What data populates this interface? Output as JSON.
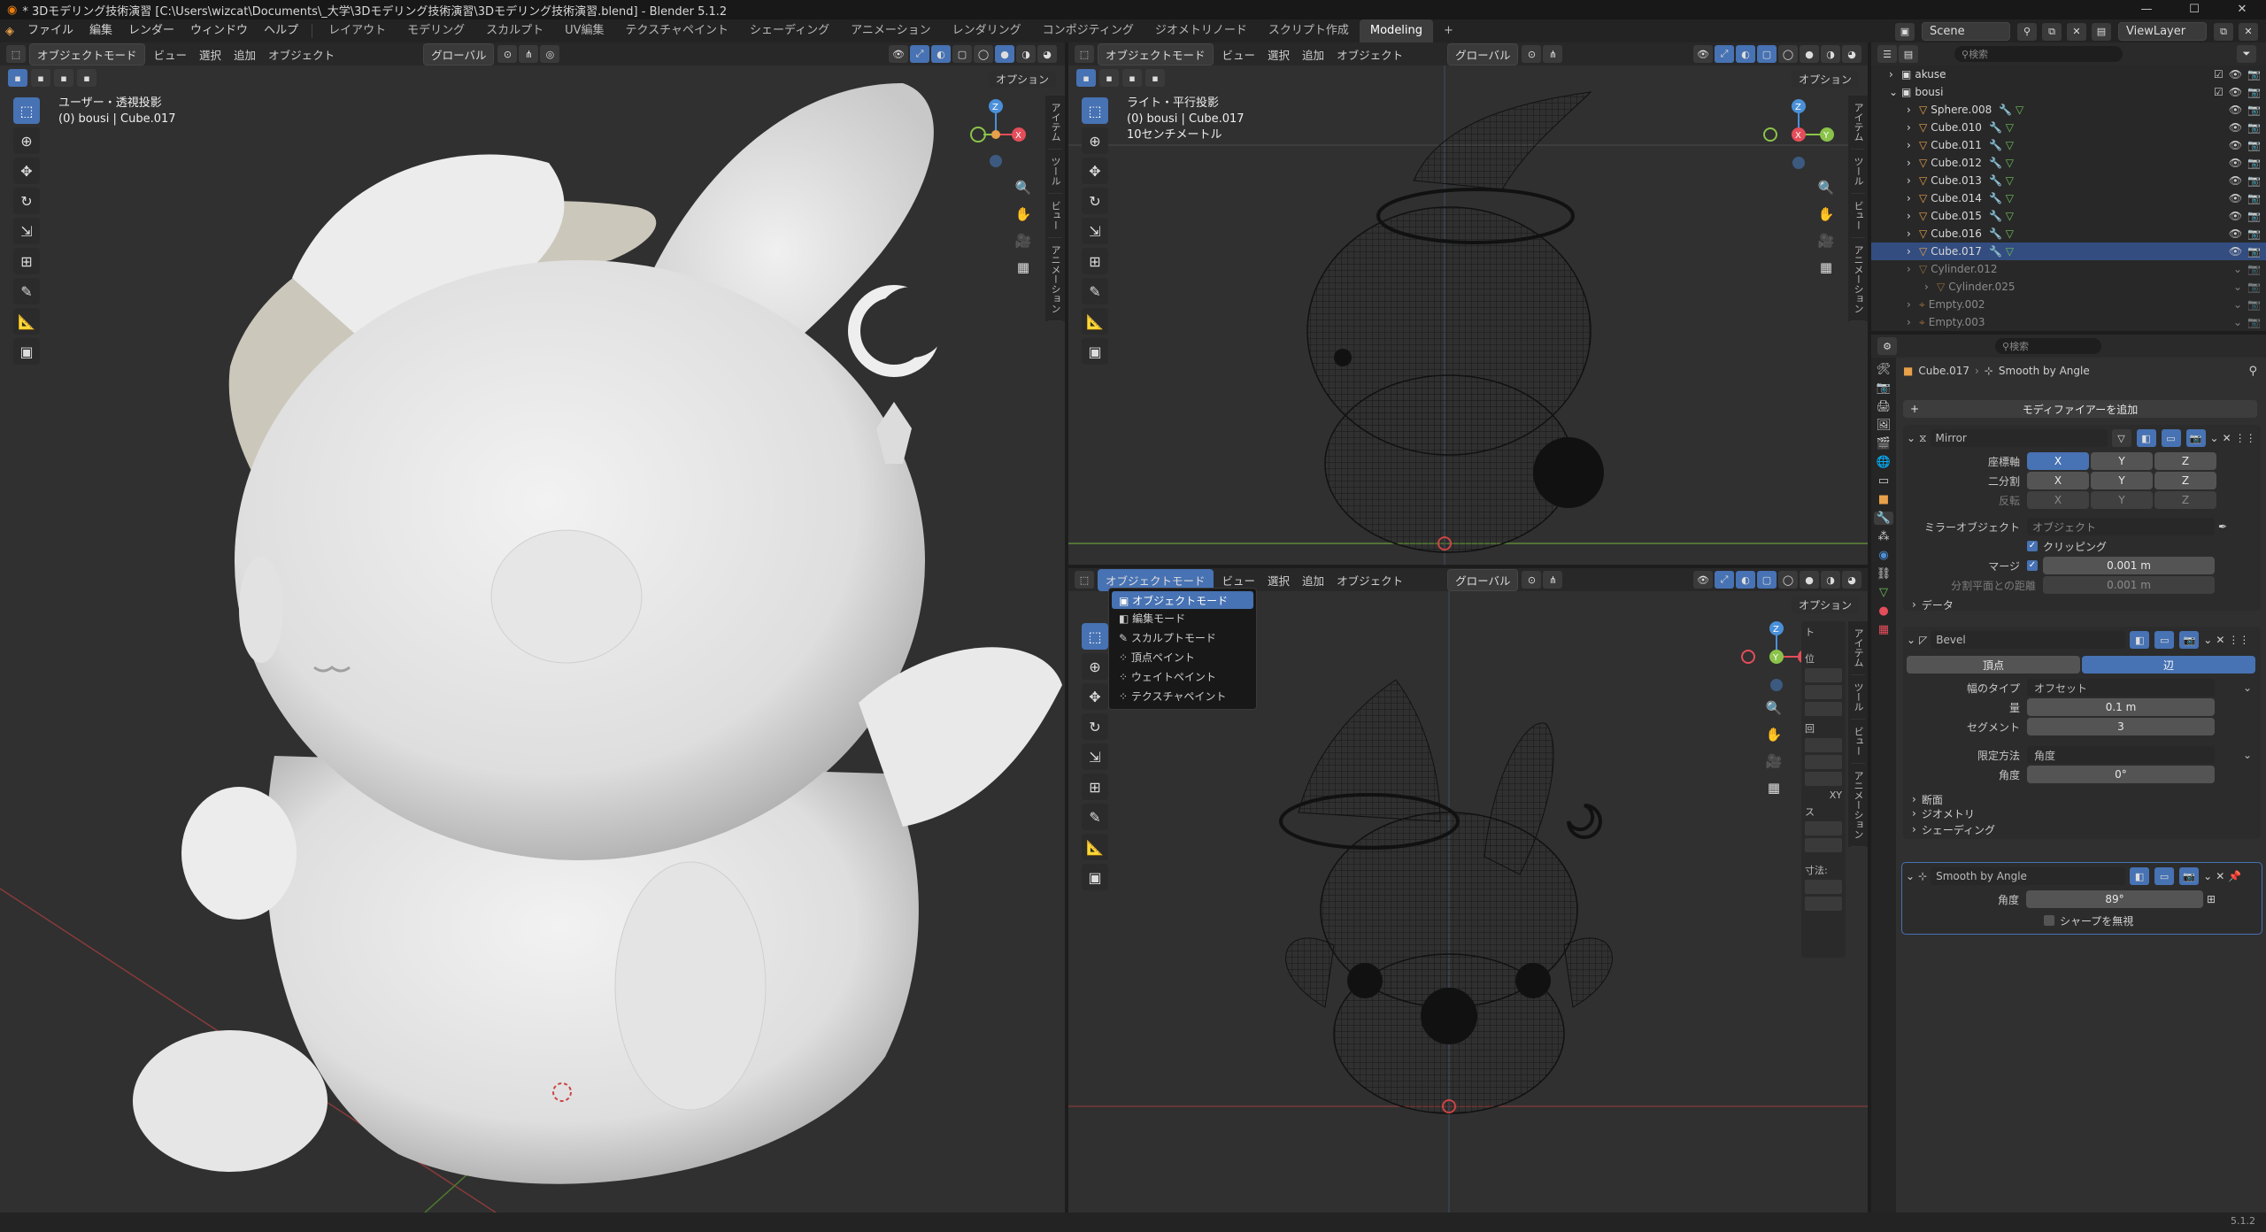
{
  "title": "* 3Dモデリング技術演習 [C:\\Users\\wizcat\\Documents\\_大学\\3Dモデリング技術演習\\3Dモデリング技術演習.blend] - Blender 5.1.2",
  "menu": [
    "ファイル",
    "編集",
    "レンダー",
    "ウィンドウ",
    "ヘルプ"
  ],
  "workspaces": [
    "レイアウト",
    "モデリング",
    "スカルプト",
    "UV編集",
    "テクスチャペイント",
    "シェーディング",
    "アニメーション",
    "レンダリング",
    "コンポジティング",
    "ジオメトリノード",
    "スクリプト作成",
    "Modeling"
  ],
  "active_workspace": "Modeling",
  "add_tab": "+",
  "scene": "Scene",
  "view_layer": "ViewLayer",
  "version": "5.1.2",
  "viewport_header": {
    "mode": "オブジェクトモード",
    "items": [
      "ビュー",
      "選択",
      "追加",
      "オブジェクト"
    ],
    "transform": "グローバル",
    "options": "オプション"
  },
  "left_viewport": {
    "overlay_line1": "ユーザー・透視投影",
    "overlay_line2": "(0) bousi | Cube.017"
  },
  "right_top_viewport": {
    "overlay_line1": "ライト・平行投影",
    "overlay_line2": "(0) bousi | Cube.017",
    "overlay_line3": "10センチメートル"
  },
  "side_tabs": [
    "アイテム",
    "ツール",
    "ビュー",
    "アニメーション"
  ],
  "gizmo": {
    "x": "X",
    "y": "Y",
    "z": "Z"
  },
  "mode_menu": {
    "items": [
      "オブジェクトモード",
      "編集モード",
      "スカルプトモード",
      "頂点ペイント",
      "ウェイトペイント",
      "テクスチャペイント"
    ],
    "selected": 0
  },
  "n_panel": {
    "labels": [
      "ト",
      "位",
      "回",
      "ス",
      "寸法:"
    ],
    "xy": "XY"
  },
  "outliner": {
    "search_placeholder": "検索",
    "rows": [
      {
        "name": "akuse",
        "depth": 1,
        "type": "collection",
        "partial": true
      },
      {
        "name": "bousi",
        "depth": 1,
        "type": "collection",
        "expanded": true
      },
      {
        "name": "Sphere.008",
        "depth": 2,
        "type": "mesh"
      },
      {
        "name": "Cube.010",
        "depth": 2,
        "type": "mesh"
      },
      {
        "name": "Cube.011",
        "depth": 2,
        "type": "mesh"
      },
      {
        "name": "Cube.012",
        "depth": 2,
        "type": "mesh"
      },
      {
        "name": "Cube.013",
        "depth": 2,
        "type": "mesh"
      },
      {
        "name": "Cube.014",
        "depth": 2,
        "type": "mesh"
      },
      {
        "name": "Cube.015",
        "depth": 2,
        "type": "mesh"
      },
      {
        "name": "Cube.016",
        "depth": 2,
        "type": "mesh"
      },
      {
        "name": "Cube.017",
        "depth": 2,
        "type": "mesh",
        "selected": true
      },
      {
        "name": "Cylinder.012",
        "depth": 2,
        "type": "mesh",
        "dim": true
      },
      {
        "name": "Cylinder.025",
        "depth": 3,
        "type": "mesh",
        "dim": true
      },
      {
        "name": "Empty.002",
        "depth": 2,
        "type": "empty",
        "dim": true
      },
      {
        "name": "Empty.003",
        "depth": 2,
        "type": "empty",
        "dim": true
      }
    ]
  },
  "properties": {
    "search_placeholder": "検索",
    "breadcrumb_object": "Cube.017",
    "breadcrumb_modifier": "Smooth by Angle",
    "add_modifier": "モディファイアーを追加",
    "mirror": {
      "name": "Mirror",
      "axis_label": "座標軸",
      "bisect_label": "二分割",
      "flip_label": "反転",
      "axes": [
        "X",
        "Y",
        "Z"
      ],
      "mirror_object_label": "ミラーオブジェクト",
      "mirror_object_placeholder": "オブジェクト",
      "clipping_label": "クリッピング",
      "merge_label": "マージ",
      "merge_value": "0.001 m",
      "bisect_distance_label": "分割平面との距離",
      "bisect_distance_value": "0.001 m",
      "data_label": "データ"
    },
    "bevel": {
      "name": "Bevel",
      "tab_vertices": "頂点",
      "tab_edges": "辺",
      "width_type_label": "幅のタイプ",
      "width_type_value": "オフセット",
      "amount_label": "量",
      "amount_value": "0.1 m",
      "segments_label": "セグメント",
      "segments_value": "3",
      "limit_method_label": "限定方法",
      "limit_method_value": "角度",
      "angle_label": "角度",
      "angle_value": "0°",
      "sections": [
        "断面",
        "ジオメトリ",
        "シェーディング"
      ]
    },
    "smooth": {
      "name": "Smooth by Angle",
      "angle_label": "角度",
      "angle_value": "89°",
      "ignore_sharp_label": "シャープを無視"
    }
  },
  "colors": {
    "accent": "#4772b3",
    "viewport_bg": "#303030",
    "header_bg": "#282828",
    "axis_x": "#e44d5a",
    "axis_y": "#8bc34a",
    "axis_z": "#4a90d9",
    "mesh_orange": "#e8a04a",
    "data_green": "#6fc05a"
  }
}
